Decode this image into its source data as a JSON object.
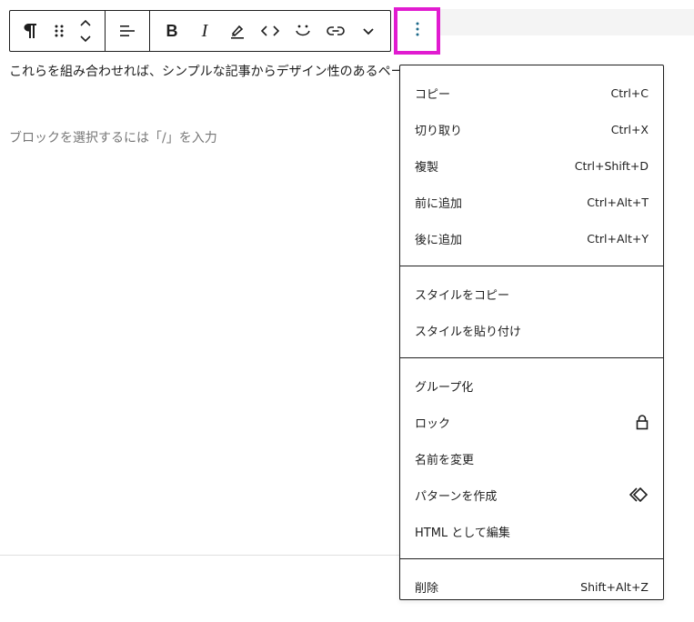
{
  "editor": {
    "paragraph_text": "これらを組み合わせれば、シンプルな記事からデザイン性のあるペー",
    "placeholder_text": "ブロックを選択するには「/」を入力"
  },
  "toolbar": {
    "paragraph_icon": "pilcrow-icon",
    "drag_icon": "drag-handle-icon",
    "move_icon": "move-up-down-icon",
    "align_icon": "align-left-icon",
    "bold_label": "B",
    "italic_label": "I",
    "highlight_icon": "highlighter-icon",
    "code_icon": "code-icon",
    "emoji_icon": "smiley-icon",
    "link_icon": "link-icon",
    "more_icon": "chevron-down-icon",
    "options_icon": "vertical-ellipsis-icon",
    "options_highlight_color": "#e11bd0"
  },
  "menu": {
    "group1": [
      {
        "label": "コピー",
        "shortcut": "Ctrl+C"
      },
      {
        "label": "切り取り",
        "shortcut": "Ctrl+X"
      },
      {
        "label": "複製",
        "shortcut": "Ctrl+Shift+D"
      },
      {
        "label": "前に追加",
        "shortcut": "Ctrl+Alt+T"
      },
      {
        "label": "後に追加",
        "shortcut": "Ctrl+Alt+Y"
      }
    ],
    "group2": [
      {
        "label": "スタイルをコピー"
      },
      {
        "label": "スタイルを貼り付け"
      }
    ],
    "group3": [
      {
        "label": "グループ化"
      },
      {
        "label": "ロック",
        "icon": "lock-icon"
      },
      {
        "label": "名前を変更"
      },
      {
        "label": "パターンを作成",
        "icon": "pattern-diamond-icon"
      },
      {
        "label": "HTML として編集"
      }
    ],
    "group4": [
      {
        "label": "削除",
        "shortcut": "Shift+Alt+Z"
      }
    ]
  }
}
